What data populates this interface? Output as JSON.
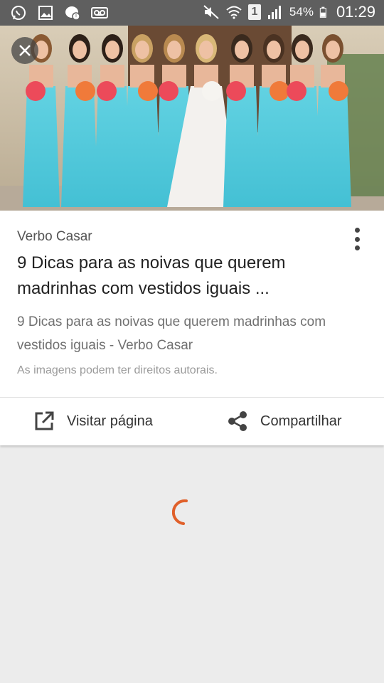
{
  "status_bar": {
    "battery_percent": "54%",
    "time": "01:29",
    "sim_slot": "1"
  },
  "card": {
    "source": "Verbo Casar",
    "title": "9 Dicas para as noivas que querem madrinhas com vestidos iguais ...",
    "description": "9 Dicas para as noivas que querem madrinhas com vestidos iguais - Verbo Casar",
    "copyright_notice": "As imagens podem ter direitos autorais.",
    "actions": {
      "visit_label": "Visitar página",
      "share_label": "Compartilhar"
    }
  },
  "colors": {
    "status_bar": "#5f5f5f",
    "dress_blue": "#5fd0e0",
    "spinner": "#e0602a",
    "background": "#ececec"
  },
  "icons": {
    "status_left": [
      "whatsapp-icon",
      "gallery-icon",
      "chat-icon",
      "voicemail-icon"
    ],
    "status_right": [
      "mute-icon",
      "wifi-icon",
      "sim-icon",
      "signal-icon",
      "battery-icon"
    ],
    "close": "close-icon",
    "more": "more-vert-icon",
    "visit": "open-in-new-icon",
    "share": "share-icon"
  }
}
